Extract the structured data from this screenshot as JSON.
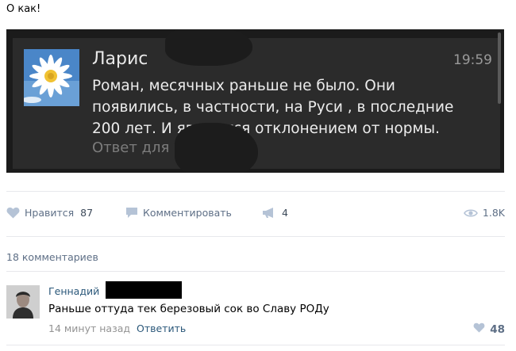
{
  "post": {
    "text": "О как!"
  },
  "notification": {
    "sender": "Ларис",
    "time": "19:59",
    "lines": [
      "Роман, месячных раньше не было. Они",
      "появились, в частности, на Руси , в последние",
      "200 лет. И являются отклонением от нормы."
    ],
    "reply_hint": "Ответ для"
  },
  "actions": {
    "like_label": "Нравится",
    "like_count": "87",
    "comment_label": "Комментировать",
    "share_count": "4",
    "views_count": "1.8K",
    "icons": [
      "heart-icon",
      "comment-icon",
      "megaphone-icon",
      "eye-icon"
    ]
  },
  "comments_header": "18 комментариев",
  "comment": {
    "author": "Геннадий",
    "text": "Раньше оттуда тек березовый сок во Славу РОДу",
    "time": "14 минут назад",
    "reply_label": "Ответить",
    "likes": "48"
  },
  "colors": {
    "link": "#2b587a",
    "meta": "#5e6f86",
    "icon": "#b5c3d6",
    "screenshot_bg": "#2b2b2b"
  }
}
